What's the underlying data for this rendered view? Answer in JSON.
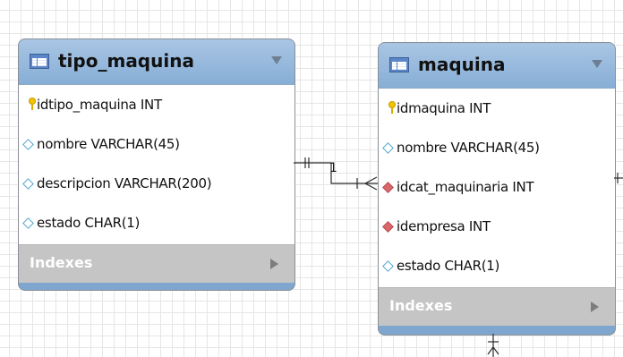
{
  "tables": [
    {
      "name": "tipo_maquina",
      "columns": [
        {
          "label": "idtipo_maquina INT",
          "kind": "primary-key"
        },
        {
          "label": "nombre VARCHAR(45)",
          "kind": "attribute"
        },
        {
          "label": "descripcion VARCHAR(200)",
          "kind": "attribute"
        },
        {
          "label": "estado CHAR(1)",
          "kind": "attribute"
        }
      ],
      "indexes_label": "Indexes"
    },
    {
      "name": "maquina",
      "columns": [
        {
          "label": "idmaquina INT",
          "kind": "primary-key"
        },
        {
          "label": "nombre VARCHAR(45)",
          "kind": "attribute"
        },
        {
          "label": "idcat_maquinaria INT",
          "kind": "foreign-key"
        },
        {
          "label": "idempresa INT",
          "kind": "foreign-key"
        },
        {
          "label": "estado CHAR(1)",
          "kind": "attribute"
        }
      ],
      "indexes_label": "Indexes"
    }
  ],
  "relationship": {
    "from": "tipo_maquina",
    "to": "maquina",
    "label": "1",
    "cardinality": "one-to-many"
  },
  "colors": {
    "header": "#a9c6e4",
    "body": "#ffffff",
    "indexes": "#c5c5c5",
    "table_footer": "#7ea6cf",
    "grid": "#e6e6e6",
    "primary_key": "#f2c400",
    "foreign_key": "#d9686b",
    "attribute": "#4fa7cf"
  }
}
